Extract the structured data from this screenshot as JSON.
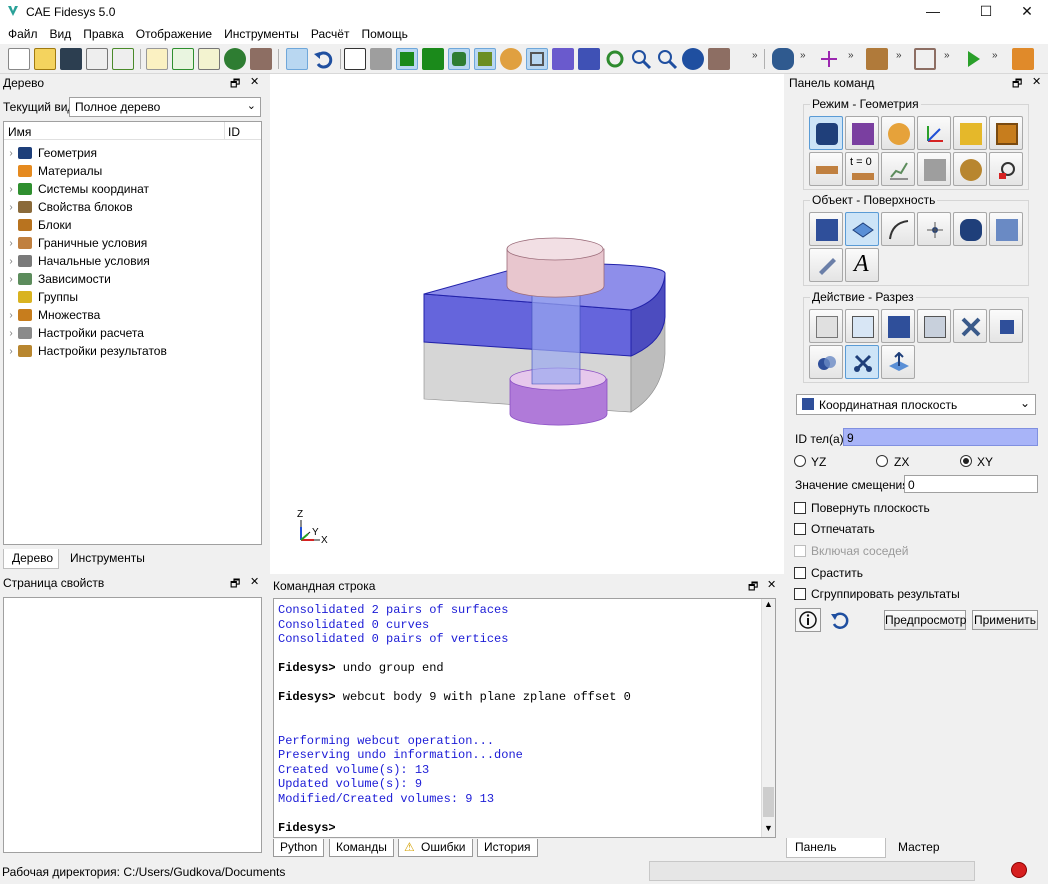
{
  "window": {
    "title": "CAE Fidesys 5.0",
    "minimize": "—",
    "maximize": "☐",
    "close": "✕"
  },
  "menu": [
    "Файл",
    "Вид",
    "Правка",
    "Отображение",
    "Инструменты",
    "Расчёт",
    "Помощь"
  ],
  "toolbar": {
    "overflow": "»"
  },
  "tree_panel": {
    "title": "Дерево",
    "current_view_label": "Текущий вид",
    "current_view_value": "Полное дерево",
    "col_name": "Имя",
    "col_id": "ID",
    "items": [
      {
        "label": "Геометрия",
        "color": "#1e3f7a"
      },
      {
        "label": "Материалы",
        "color": "#e58a1f"
      },
      {
        "label": "Системы координат",
        "color": "#2f8f2f"
      },
      {
        "label": "Свойства блоков",
        "color": "#8a6a3a"
      },
      {
        "label": "Блоки",
        "color": "#b8731f"
      },
      {
        "label": "Граничные условия",
        "color": "#c08040"
      },
      {
        "label": "Начальные условия",
        "color": "#7a7a7a"
      },
      {
        "label": "Зависимости",
        "color": "#5c8c5c"
      },
      {
        "label": "Группы",
        "color": "#d9b320"
      },
      {
        "label": "Множества",
        "color": "#c77d1d"
      },
      {
        "label": "Настройки расчета",
        "color": "#8a8a8a"
      },
      {
        "label": "Настройки результатов",
        "color": "#b8862f"
      }
    ],
    "tabs": [
      "Дерево",
      "Инструменты"
    ]
  },
  "properties_panel": {
    "title": "Страница свойств"
  },
  "axes": {
    "z": "Z",
    "y": "Y",
    "x": "X"
  },
  "console": {
    "title": "Командная строка",
    "lines": [
      {
        "t": "Consolidated 2 pairs of surfaces",
        "c": "blue"
      },
      {
        "t": "Consolidated 0 curves",
        "c": "blue"
      },
      {
        "t": "Consolidated 0 pairs of vertices",
        "c": "blue"
      },
      {
        "t": "",
        "c": "blue"
      },
      {
        "p": "Fidesys>",
        "t": " undo group end",
        "c": "blk"
      },
      {
        "t": "",
        "c": "blue"
      },
      {
        "p": "Fidesys>",
        "t": " webcut body 9 with plane zplane offset 0",
        "c": "blk"
      },
      {
        "t": "",
        "c": "blue"
      },
      {
        "t": "",
        "c": "blue"
      },
      {
        "t": "Performing webcut operation...",
        "c": "blue"
      },
      {
        "t": "Preserving undo information...done",
        "c": "blue"
      },
      {
        "t": "Created volume(s): 13",
        "c": "blue"
      },
      {
        "t": "Updated volume(s): 9",
        "c": "blue"
      },
      {
        "t": "Modified/Created volumes: 9 13",
        "c": "blue"
      },
      {
        "t": "",
        "c": "blue"
      },
      {
        "p": "Fidesys>",
        "t": "",
        "c": "blk"
      }
    ],
    "tabs": [
      "Python",
      "Команды",
      "Ошибки",
      "История"
    ]
  },
  "command_panel": {
    "title": "Панель команд",
    "group1": "Режим - Геометрия",
    "group2": "Объект - Поверхность",
    "group3": "Действие - Разрез",
    "t0_label": "t = 0",
    "text_icon": "A",
    "dropdown": "Координатная плоскость",
    "body_id_label": "ID тел(а)",
    "body_id_value": "9",
    "radio": [
      "YZ",
      "ZX",
      "XY"
    ],
    "offset_label": "Значение смещения",
    "offset_value": "0",
    "checks": [
      "Повернуть плоскость",
      "Отпечатать",
      "Включая соседей",
      "Срастить",
      "Сгруппировать результаты"
    ],
    "preview": "Предпросмотр",
    "apply": "Применить",
    "tabs": [
      "Панель команд",
      "Мастер"
    ]
  },
  "status": {
    "workdir": "Рабочая директория: C:/Users/Gudkova/Documents"
  }
}
